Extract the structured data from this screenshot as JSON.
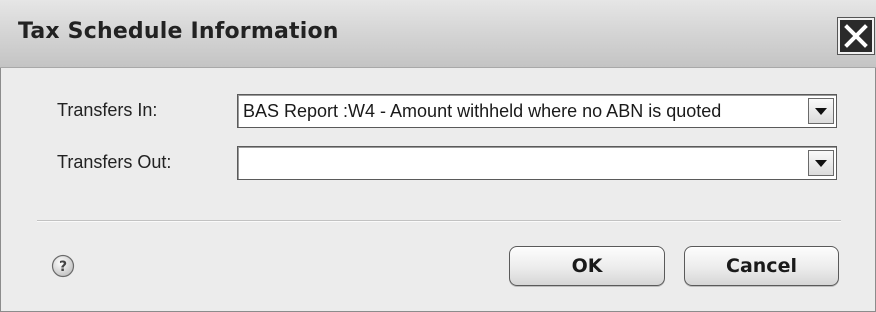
{
  "window": {
    "title": "Tax Schedule Information"
  },
  "fields": {
    "transfers_in": {
      "label": "Transfers In:",
      "value": "BAS Report :W4 - Amount withheld where no ABN is quoted"
    },
    "transfers_out": {
      "label": "Transfers Out:",
      "value": ""
    }
  },
  "buttons": {
    "ok_label": "OK",
    "cancel_label": "Cancel"
  },
  "icons": {
    "close": "close-icon",
    "help": "help-icon",
    "dropdown": "chevron-down-icon"
  },
  "colors": {
    "background": "#ececec",
    "title_text": "#222222",
    "close_button": "#2a2a2a"
  }
}
